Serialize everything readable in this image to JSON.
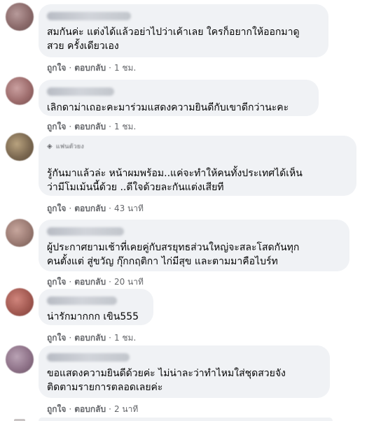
{
  "comments": [
    {
      "text_lines": [
        "สมกันค่ะ แต่งได้แล้วอย่าไปว่าเค้าเลย ใครก็อยากให้ออกมาดู",
        "สวย ครั้งเดียวเอง"
      ],
      "like": "ถูกใจ",
      "reply": "ตอบกลับ",
      "time": "1 ชม."
    },
    {
      "text_lines": [
        "เลิกดาม่าเถอะคะมาร่วมแสดงความยินดีกับเขาดีกว่านะคะ"
      ],
      "like": "ถูกใจ",
      "reply": "ตอบกลับ",
      "time": "1 ชม."
    },
    {
      "badge": "แฟนตัวยง",
      "text_lines": [
        "รู้กันมาแล้วล่ะ หน้าผมพร้อม..แค่จะทำให้คนทั้งประเทศได้เห็น",
        "ว่ามีโมเม้นนี้ด้วย ..ดีใจด้วยละกันแต่งเสียที"
      ],
      "like": "ถูกใจ",
      "reply": "ตอบกลับ",
      "time": "43 นาที"
    },
    {
      "text_lines": [
        "ผู้ประกาศยามเช้าที่เคยคู่กับสรยุทธส่วนใหญ่จะสละโสดกันทุก",
        "คนตั้งแต่ สู่ขวัญ กุ๊กกฤติกา ไก่มีสุข และตามมาคือไบร์ท"
      ],
      "like": "ถูกใจ",
      "reply": "ตอบกลับ",
      "time": "20 นาที"
    },
    {
      "text_lines": [
        "น่ารักมากกก เขิน555"
      ],
      "like": "ถูกใจ",
      "reply": "ตอบกลับ",
      "time": "1 ชม."
    },
    {
      "text_lines": [
        "ขอแสดงความยินดีด้วยค่ะ ไม่น่าละว่าทำไหมใส่ชุดสวยจัง",
        "ติดตามรายการตลอดเลยค่ะ"
      ],
      "like": "ถูกใจ",
      "reply": "ตอบกลับ",
      "time": "2 นาที"
    }
  ]
}
